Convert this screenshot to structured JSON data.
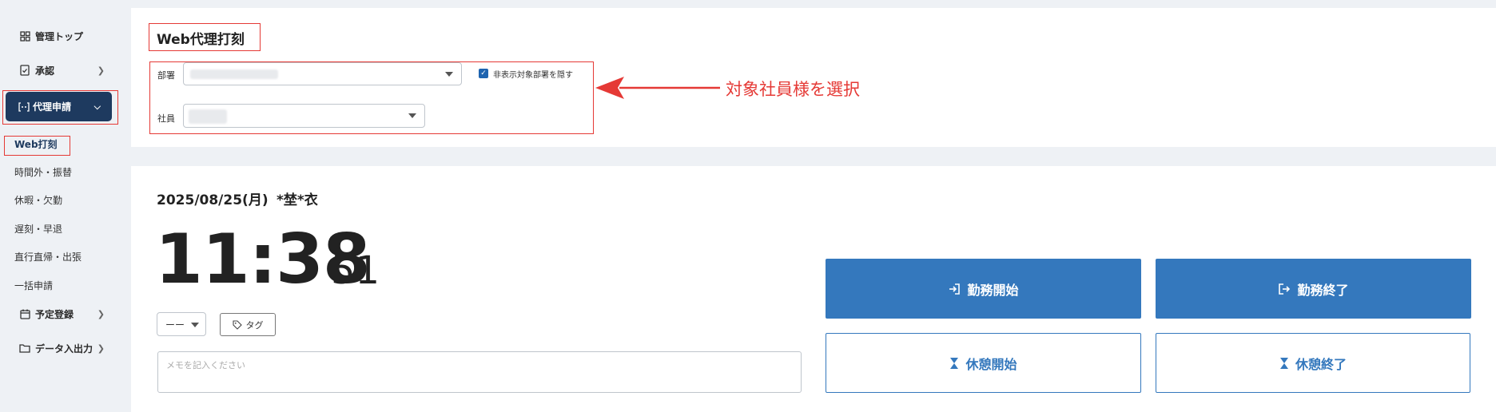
{
  "sidebar": {
    "items": [
      {
        "label": "管理トップ",
        "icon": "grid-icon"
      },
      {
        "label": "承認",
        "icon": "document-check-icon"
      },
      {
        "label": "代理申請",
        "icon": "proxy-icon"
      },
      {
        "label": "予定登録",
        "icon": "calendar-icon"
      },
      {
        "label": "データ入出力",
        "icon": "folder-icon"
      }
    ],
    "subitems": [
      "Web打刻",
      "時間外・振替",
      "休暇・欠勤",
      "遅刻・早退",
      "直行直帰・出張",
      "一括申請"
    ]
  },
  "header": {
    "title": "Web代理打刻",
    "department_label": "部署",
    "employee_label": "社員",
    "hide_checkbox_label": "非表示対象部署を隠す",
    "hide_checked": true
  },
  "annotation": {
    "text": "対象社員様を選択",
    "color": "#e53935"
  },
  "clock": {
    "date": "2025/08/25(月)",
    "employee_name": "*埜*衣",
    "time": "11:38",
    "seconds": "51"
  },
  "controls": {
    "dash_select": "ーー",
    "tag_label": "タグ",
    "memo_placeholder": "メモを記入ください"
  },
  "buttons": {
    "work_start": "勤務開始",
    "work_end": "勤務終了",
    "break_start": "休憩開始",
    "break_end": "休憩終了"
  },
  "colors": {
    "primary": "#3478bd",
    "nav_active": "#1e3a5f",
    "highlight": "#e53935"
  }
}
